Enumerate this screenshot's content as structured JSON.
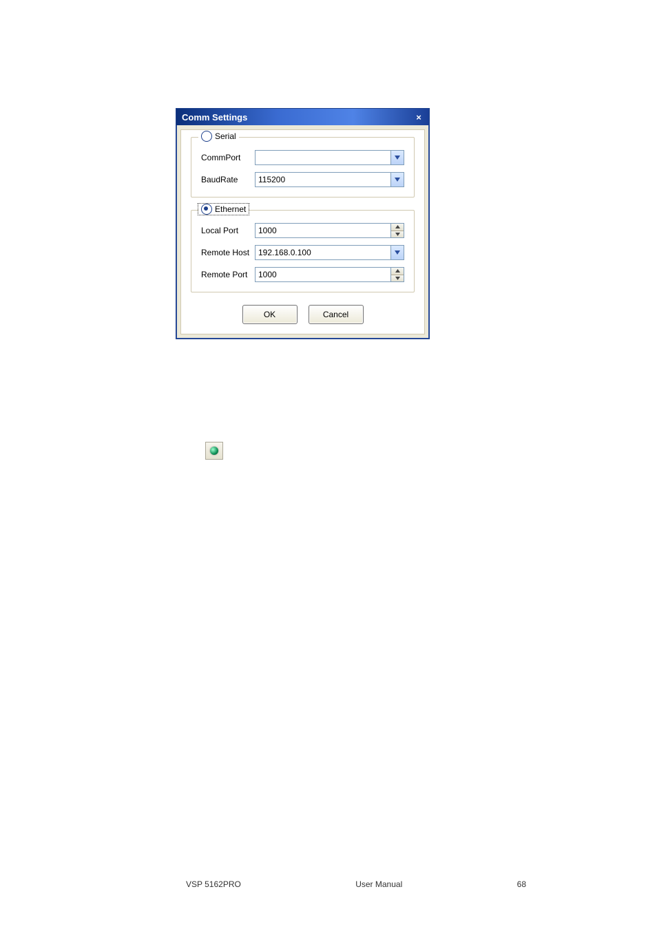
{
  "dialog": {
    "title": "Comm Settings",
    "close_label": "×",
    "serial": {
      "legend": "Serial",
      "checked": false,
      "commport": {
        "label": "CommPort",
        "value": ""
      },
      "baudrate": {
        "label": "BaudRate",
        "value": "115200"
      }
    },
    "ethernet": {
      "legend": "Ethernet",
      "checked": true,
      "localport": {
        "label": "Local Port",
        "value": "1000"
      },
      "remotehost": {
        "label": "Remote Host",
        "value": "192.168.0.100"
      },
      "remoteport": {
        "label": "Remote Port",
        "value": "1000"
      }
    },
    "buttons": {
      "ok": "OK",
      "cancel": "Cancel"
    }
  },
  "toolbar_button": {
    "name": "connection-indicator"
  },
  "footer": {
    "left": "VSP 5162PRO",
    "center": "User Manual",
    "right": "68"
  }
}
